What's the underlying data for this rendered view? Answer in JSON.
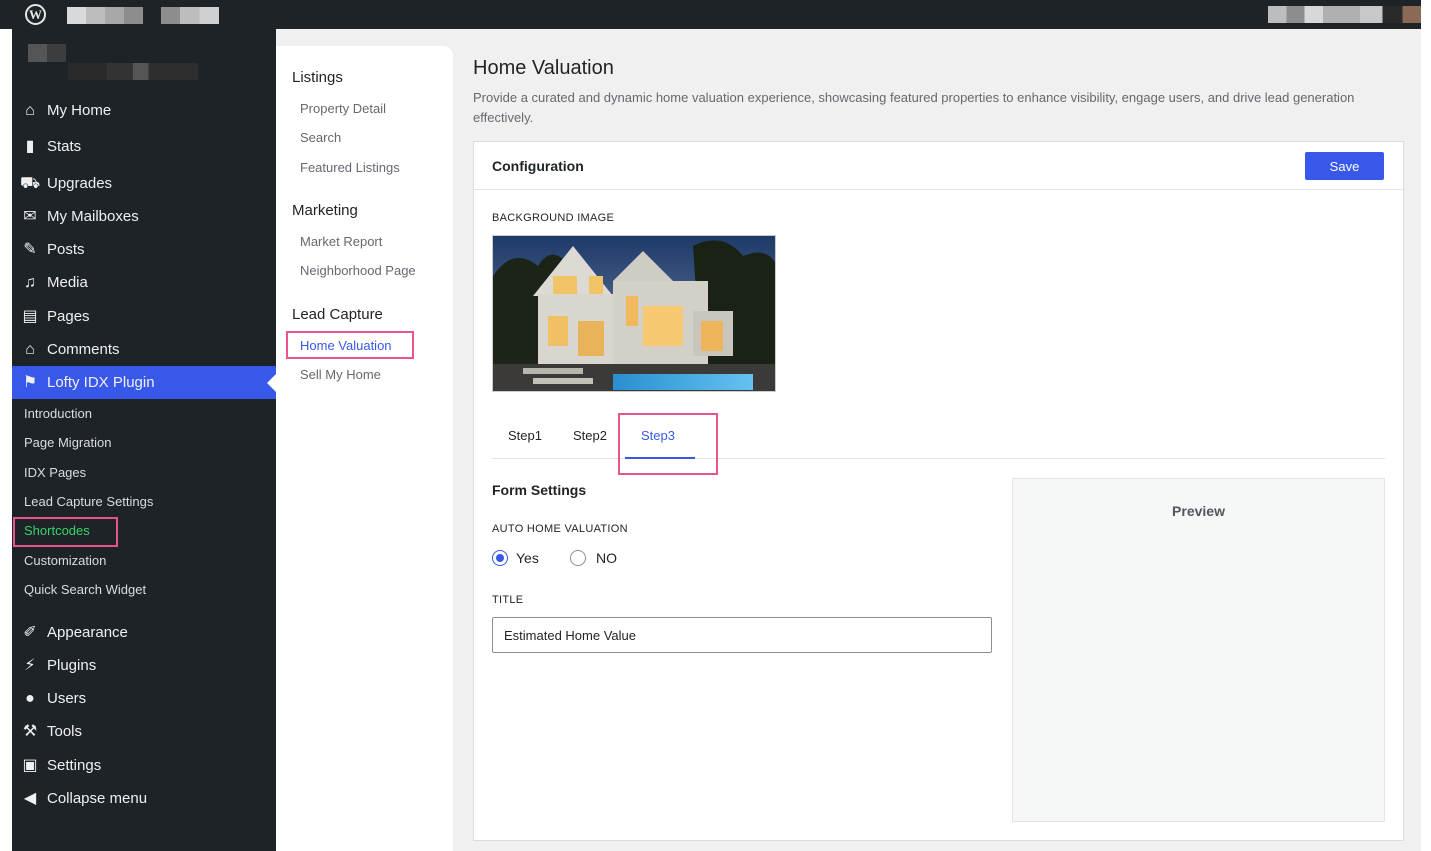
{
  "sidebar": {
    "menu": [
      {
        "label": "My Home",
        "icon": "home-icon"
      },
      {
        "label": "Stats",
        "icon": "bar-chart-icon"
      },
      {
        "label": "Upgrades",
        "icon": "cart-icon"
      },
      {
        "label": "My Mailboxes",
        "icon": "mail-icon"
      },
      {
        "label": "Posts",
        "icon": "pin-icon"
      },
      {
        "label": "Media",
        "icon": "media-icon"
      },
      {
        "label": "Pages",
        "icon": "pages-icon"
      },
      {
        "label": "Comments",
        "icon": "comments-icon"
      },
      {
        "label": "Lofty IDX Plugin",
        "icon": "lofty-icon"
      }
    ],
    "submenu": [
      {
        "label": "Introduction"
      },
      {
        "label": "Page Migration"
      },
      {
        "label": "IDX Pages"
      },
      {
        "label": "Lead Capture Settings"
      },
      {
        "label": "Shortcodes"
      },
      {
        "label": "Customization"
      },
      {
        "label": "Quick Search Widget"
      }
    ],
    "menu_bottom": [
      {
        "label": "Appearance",
        "icon": "brush-icon"
      },
      {
        "label": "Plugins",
        "icon": "plug-icon"
      },
      {
        "label": "Users",
        "icon": "user-icon"
      },
      {
        "label": "Tools",
        "icon": "wrench-icon"
      },
      {
        "label": "Settings",
        "icon": "settings-icon"
      },
      {
        "label": "Collapse menu",
        "icon": "collapse-icon"
      }
    ]
  },
  "subnav": {
    "groups": [
      {
        "heading": "Listings",
        "links": [
          "Property Detail",
          "Search",
          "Featured Listings"
        ]
      },
      {
        "heading": "Marketing",
        "links": [
          "Market Report",
          "Neighborhood Page"
        ]
      },
      {
        "heading": "Lead Capture",
        "links": [
          "Home Valuation",
          "Sell My Home"
        ]
      }
    ],
    "active": "Home Valuation"
  },
  "main": {
    "title": "Home Valuation",
    "description": "Provide a curated and dynamic home valuation experience, showcasing featured properties to enhance visibility, engage users, and drive lead generation effectively.",
    "config": {
      "title": "Configuration",
      "save_label": "Save",
      "background_label": "BACKGROUND IMAGE",
      "tabs": [
        "Step1",
        "Step2",
        "Step3"
      ],
      "active_tab": "Step3",
      "form_settings_title": "Form Settings",
      "auto_label": "AUTO HOME VALUATION",
      "radio_yes": "Yes",
      "radio_no": "NO",
      "radio_selected": "Yes",
      "title_label": "TITLE",
      "title_value": "Estimated Home Value",
      "preview_title": "Preview"
    }
  },
  "colors": {
    "accent": "#3858e9",
    "admin_dark": "#1d2327",
    "highlight": "#e8558d",
    "shortcodes_green": "#3ad36c"
  }
}
